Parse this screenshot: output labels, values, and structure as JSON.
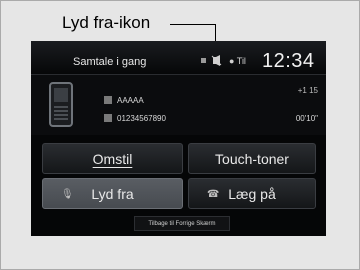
{
  "callout": {
    "label": "Lyd fra-ikon"
  },
  "status_bar": {
    "title": "Samtale i gang",
    "mute_indicator_icon": "mute-indicator-icon",
    "signal_text": "● Til",
    "clock": "12:34"
  },
  "call": {
    "contact_name": "AAAAA",
    "contact_number": "01234567890",
    "call_count": "+1 15",
    "call_duration": "00'10\""
  },
  "buttons": {
    "forward": "Omstil",
    "touch_tones": "Touch-toner",
    "mute": "Lyd fra",
    "hang_up": "Læg på",
    "back": "Tilbage til Forrige Skærm"
  }
}
